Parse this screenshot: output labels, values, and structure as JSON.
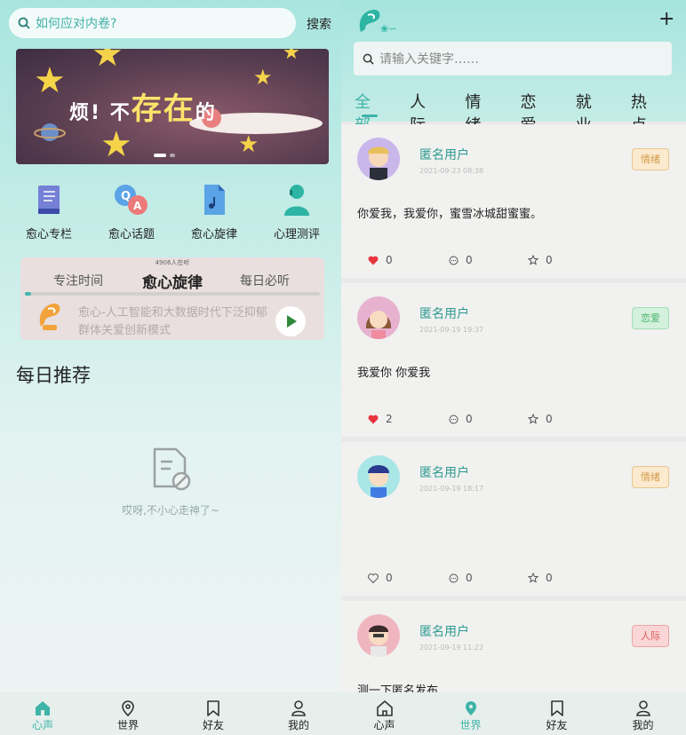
{
  "colors": {
    "accent": "#3fb3a8",
    "heart": "#e8343c",
    "header_teal": "#a6e4de"
  },
  "left": {
    "search": {
      "placeholder": "如何应对内卷?",
      "button": "搜索"
    },
    "banner": {
      "text_small": "烦! 不",
      "text_big": "存在",
      "text_tail": "的"
    },
    "quick_links": [
      {
        "label": "愈心专栏",
        "icon": "book-icon"
      },
      {
        "label": "愈心话题",
        "icon": "qa-bubble-icon"
      },
      {
        "label": "愈心旋律",
        "icon": "music-file-icon"
      },
      {
        "label": "心理测评",
        "icon": "counselor-icon"
      }
    ],
    "player": {
      "listeners": "4906人在听",
      "tabs": [
        "专注时间",
        "愈心旋律",
        "每日必听"
      ],
      "active_tab": "愈心旋律",
      "progress": 0.02,
      "description": "愈心-人工智能和大数据时代下泛抑郁群体关爱创新模式"
    },
    "daily_title": "每日推荐",
    "empty_text": "哎呀,不小心走神了~",
    "tabbar": [
      {
        "label": "心声",
        "icon": "home-icon",
        "active": true
      },
      {
        "label": "世界",
        "icon": "location-pin-icon",
        "active": false
      },
      {
        "label": "好友",
        "icon": "bookmark-icon",
        "active": false
      },
      {
        "label": "我的",
        "icon": "user-icon",
        "active": false
      }
    ]
  },
  "right": {
    "plus": "+",
    "search_placeholder": "请输入关键字……",
    "categories": [
      "全部",
      "人际",
      "情绪",
      "恋爱",
      "就业",
      "热点"
    ],
    "active_category": "全部",
    "posts": [
      {
        "user": "匿名用户",
        "time": "2021-09-23 08:38",
        "tag": "情绪",
        "tag_style": "qx",
        "content": "你爱我，我爱你，蜜雪冰城甜蜜蜜。",
        "likes": "0",
        "comments": "0",
        "stars": "0",
        "liked": true,
        "avatar": "boy-purple-bg"
      },
      {
        "user": "匿名用户",
        "time": "2021-09-19 19:37",
        "tag": "恋爱",
        "tag_style": "la",
        "content": "我爱你 你爱我",
        "likes": "2",
        "comments": "0",
        "stars": "0",
        "liked": true,
        "avatar": "girl-pink-bg"
      },
      {
        "user": "匿名用户",
        "time": "2021-09-19 18:17",
        "tag": "情绪",
        "tag_style": "qx",
        "content": "",
        "likes": "0",
        "comments": "0",
        "stars": "0",
        "liked": false,
        "avatar": "boy-blue-bg"
      },
      {
        "user": "匿名用户",
        "time": "2021-09-19 11:22",
        "tag": "人际",
        "tag_style": "rj",
        "content": "测一下匿名发布",
        "likes": "",
        "comments": "",
        "stars": "",
        "liked": false,
        "avatar": "man-pink-bg"
      }
    ],
    "tabbar": [
      {
        "label": "心声",
        "icon": "home-icon",
        "active": false
      },
      {
        "label": "世界",
        "icon": "location-pin-icon",
        "active": true
      },
      {
        "label": "好友",
        "icon": "bookmark-icon",
        "active": false
      },
      {
        "label": "我的",
        "icon": "user-icon",
        "active": false
      }
    ]
  }
}
